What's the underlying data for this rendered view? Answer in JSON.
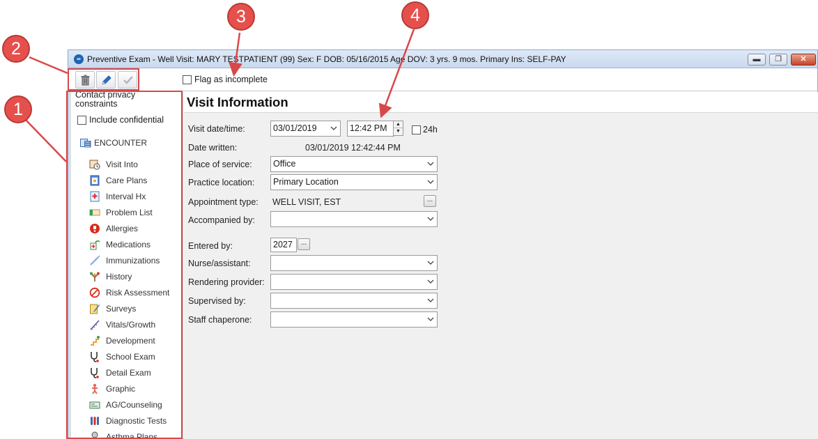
{
  "window": {
    "title": "Preventive Exam - Well Visit:  MARY TESTPATIENT (99)  Sex: F  DOB: 05/16/2015  Age DOV: 3 yrs. 9 mos.  Primary Ins: SELF-PAY",
    "min_glyph": "▬",
    "max_glyph": "❐",
    "close_glyph": "✕"
  },
  "toolbar": {
    "flag_label": "Flag as incomplete"
  },
  "sidebar": {
    "privacy_text": "Contact privacy constraints",
    "include_confidential": "Include confidential",
    "section_label": "ENCOUNTER",
    "items": [
      {
        "label": "Visit Into",
        "icon": "visit-info-icon"
      },
      {
        "label": "Care Plans",
        "icon": "care-plans-icon"
      },
      {
        "label": "Interval Hx",
        "icon": "interval-hx-icon"
      },
      {
        "label": "Problem List",
        "icon": "problem-list-icon"
      },
      {
        "label": "Allergies",
        "icon": "allergies-icon"
      },
      {
        "label": "Medications",
        "icon": "medications-icon"
      },
      {
        "label": "Immunizations",
        "icon": "immunizations-icon"
      },
      {
        "label": "History",
        "icon": "history-icon"
      },
      {
        "label": "Risk Assessment",
        "icon": "risk-assessment-icon"
      },
      {
        "label": "Surveys",
        "icon": "surveys-icon"
      },
      {
        "label": "Vitals/Growth",
        "icon": "vitals-growth-icon"
      },
      {
        "label": "Development",
        "icon": "development-icon"
      },
      {
        "label": "School Exam",
        "icon": "school-exam-icon"
      },
      {
        "label": "Detail Exam",
        "icon": "detail-exam-icon"
      },
      {
        "label": "Graphic",
        "icon": "graphic-icon"
      },
      {
        "label": "AG/Counseling",
        "icon": "ag-counseling-icon"
      },
      {
        "label": "Diagnostic Tests",
        "icon": "diagnostic-tests-icon"
      },
      {
        "label": "Asthma Plans",
        "icon": "asthma-plans-icon"
      }
    ]
  },
  "main": {
    "heading": "Visit Information",
    "visit_datetime_label": "Visit date/time:",
    "visit_date": "03/01/2019",
    "visit_time": "12:42 PM",
    "h24_label": "24h",
    "date_written_label": "Date written:",
    "date_written": "03/01/2019 12:42:44 PM",
    "place_label": "Place of service:",
    "place_value": "Office",
    "practice_label": "Practice location:",
    "practice_value": "Primary Location",
    "appt_label": "Appointment type:",
    "appt_value": "WELL VISIT, EST",
    "accompanied_label": "Accompanied by:",
    "accompanied_value": "",
    "entered_label": "Entered by:",
    "entered_value": "2027",
    "nurse_label": "Nurse/assistant:",
    "nurse_value": "",
    "rendering_label": "Rendering provider:",
    "rendering_value": "",
    "supervised_label": "Supervised by:",
    "supervised_value": "",
    "chaperone_label": "Staff chaperone:",
    "chaperone_value": "",
    "ellipsis": "..."
  },
  "annotations": {
    "callouts": [
      "1",
      "2",
      "3",
      "4"
    ],
    "color": "#e6504c"
  }
}
